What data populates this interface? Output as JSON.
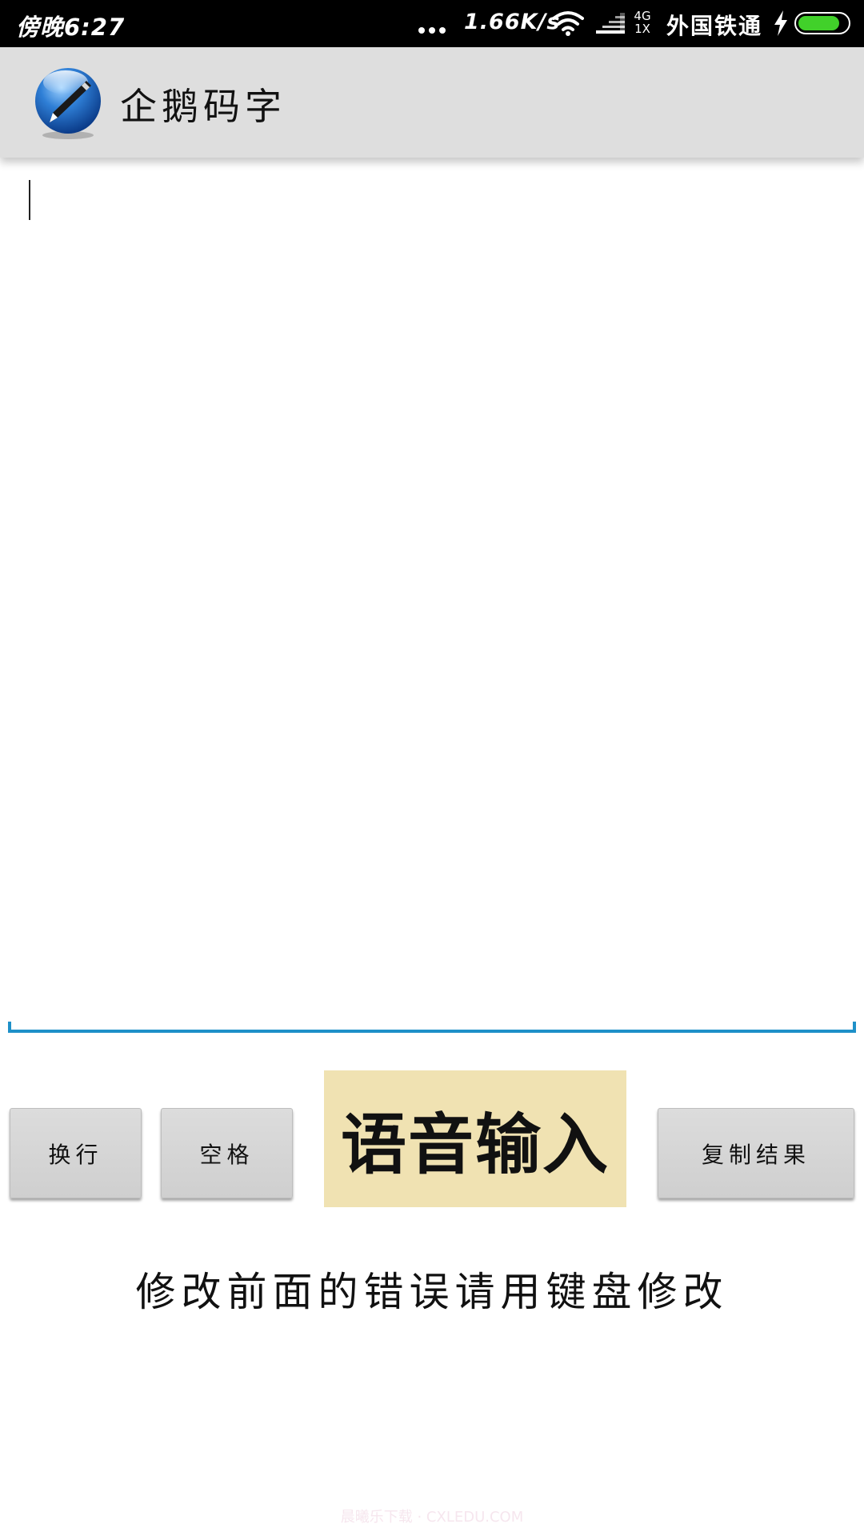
{
  "status_bar": {
    "time": "傍晚6:27",
    "network_speed": "1.66K/s",
    "network_type_top": "4G",
    "network_type_bottom": "1X",
    "carrier": "外国铁通",
    "battery_level": 0.85,
    "battery_color": "#41d12a",
    "icons": [
      "more-dots-icon",
      "wifi-icon",
      "signal-icon",
      "charging-bolt-icon",
      "battery-icon"
    ]
  },
  "app_bar": {
    "title": "企鹅码字",
    "logo_icon": "pen-globe-logo-icon",
    "background": "#dedede"
  },
  "editor": {
    "value": "",
    "underline_color": "#1e90c8"
  },
  "buttons": {
    "newline_label": "换行",
    "space_label": "空格",
    "voice_label": "语音输入",
    "voice_background": "#f0e2b2",
    "copy_label": "复制结果"
  },
  "hint_text": "修改前面的错误请用键盘修改",
  "watermark": "晨曦乐下载 · CXLEDU.COM"
}
